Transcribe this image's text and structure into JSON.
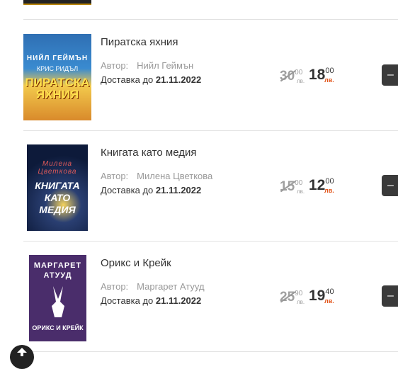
{
  "products": [
    {
      "title": "Пиратска яхния",
      "author_label": "Автор:",
      "author": "Нийл Геймън",
      "delivery_label": "Доставка до",
      "delivery_date": "21.11.2022",
      "old_price_int": "30",
      "old_price_dec": "00",
      "old_price_cur": "лв.",
      "price_int": "18",
      "price_dec": "00",
      "price_cur": "лв.",
      "cover": {
        "author": "НИЙЛ ГЕЙМЪН",
        "title": "ПИРАТСКА ЯХНИЯ",
        "sub": "КРИС РИДЪЛ"
      }
    },
    {
      "title": "Книгата като медия",
      "author_label": "Автор:",
      "author": "Милена Цветкова",
      "delivery_label": "Доставка до",
      "delivery_date": "21.11.2022",
      "old_price_int": "15",
      "old_price_dec": "00",
      "old_price_cur": "лв.",
      "price_int": "12",
      "price_dec": "00",
      "price_cur": "лв.",
      "cover": {
        "author": "Милена Цветкова",
        "title": "КНИГАТА КАТО МЕДИЯ",
        "sub": ""
      }
    },
    {
      "title": "Орикс и Крейк",
      "author_label": "Автор:",
      "author": "Маргарет Атууд",
      "delivery_label": "Доставка до",
      "delivery_date": "21.11.2022",
      "old_price_int": "25",
      "old_price_dec": "90",
      "old_price_cur": "лв.",
      "price_int": "19",
      "price_dec": "40",
      "price_cur": "лв.",
      "cover": {
        "author": "МАРГАРЕТ АТУУД",
        "title": "",
        "sub": "ОРИКС И КРЕЙК"
      }
    }
  ],
  "colors": {
    "accent": "#e2551a",
    "button": "#3a3a3a",
    "divider": "#e2e2e2"
  },
  "icons": {
    "cart": "cart-icon",
    "scroll_top": "arrow-up-icon"
  }
}
